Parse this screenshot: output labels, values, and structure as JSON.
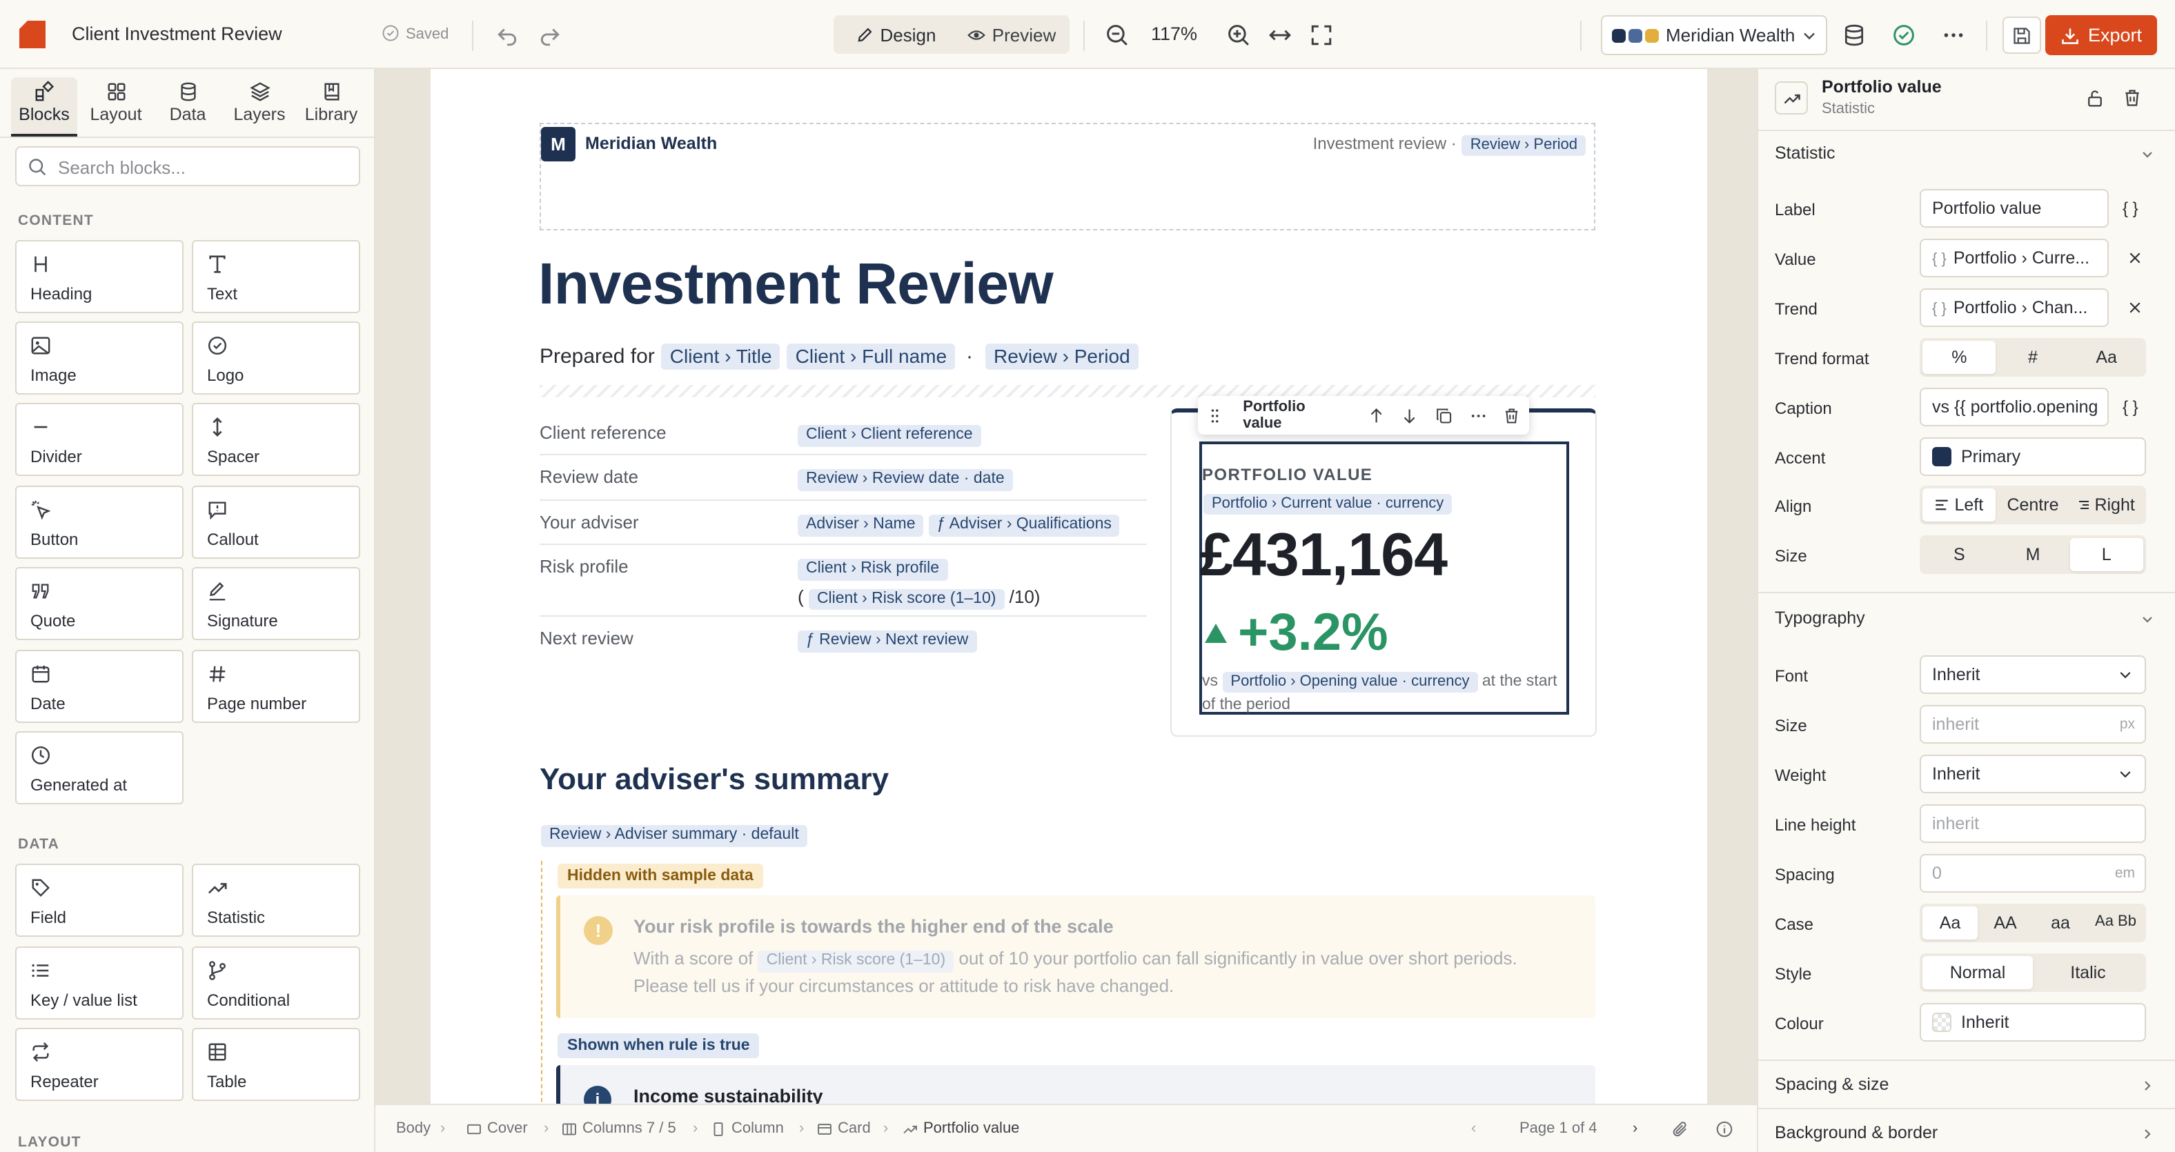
{
  "topbar": {
    "doc_title": "Client Investment Review",
    "saved_label": "Saved",
    "design_label": "Design",
    "preview_label": "Preview",
    "zoom": "117%",
    "brand_name": "Meridian Wealth",
    "export_label": "Export",
    "brand_colors": [
      "#1f3150",
      "#4b6a9a",
      "#e3ae3b"
    ],
    "accent": "#d9471c"
  },
  "left_panel": {
    "tabs": [
      "Blocks",
      "Layout",
      "Data",
      "Layers",
      "Library"
    ],
    "search_placeholder": "Search blocks...",
    "content_header": "CONTENT",
    "content_blocks": [
      {
        "label": "Heading",
        "icon": "heading-icon"
      },
      {
        "label": "Text",
        "icon": "text-icon"
      },
      {
        "label": "Image",
        "icon": "image-icon"
      },
      {
        "label": "Logo",
        "icon": "badge-check-icon"
      },
      {
        "label": "Divider",
        "icon": "divider-icon"
      },
      {
        "label": "Spacer",
        "icon": "spacer-icon"
      },
      {
        "label": "Button",
        "icon": "pointer-click-icon"
      },
      {
        "label": "Callout",
        "icon": "callout-icon"
      },
      {
        "label": "Quote",
        "icon": "quote-icon"
      },
      {
        "label": "Signature",
        "icon": "pen-icon"
      },
      {
        "label": "Date",
        "icon": "calendar-icon"
      },
      {
        "label": "Page number",
        "icon": "hash-icon"
      },
      {
        "label": "Generated at",
        "icon": "clock-icon"
      }
    ],
    "data_header": "DATA",
    "data_blocks": [
      {
        "label": "Field",
        "icon": "tag-icon"
      },
      {
        "label": "Statistic",
        "icon": "trend-icon"
      },
      {
        "label": "Key / value list",
        "icon": "list-icon"
      },
      {
        "label": "Conditional",
        "icon": "branch-icon"
      },
      {
        "label": "Repeater",
        "icon": "repeat-icon"
      },
      {
        "label": "Table",
        "icon": "table-icon"
      }
    ],
    "layout_header": "LAYOUT"
  },
  "document": {
    "brand_mark": "M",
    "brand_name": "Meridian Wealth",
    "header_right_text": "Investment review ·",
    "header_right_chip": "Review › Period",
    "title": "Investment Review",
    "prepared_for": "Prepared for",
    "prepared_chips": [
      "Client › Title",
      "Client › Full name",
      "Review › Period"
    ],
    "prepared_dot": "·",
    "details": [
      {
        "key": "Client reference",
        "chips": [
          "Client › Client reference"
        ]
      },
      {
        "key": "Review date",
        "chips": [
          "Review › Review date · date"
        ]
      },
      {
        "key": "Your adviser",
        "chips": [
          "Adviser › Name",
          "ƒ Adviser › Qualifications"
        ]
      },
      {
        "key": "Risk profile",
        "chips": [
          "Client › Risk profile"
        ],
        "line2_prefix": "(",
        "line2_chip": "Client › Risk score (1–10)",
        "line2_suffix": "/10)"
      },
      {
        "key": "Next review",
        "chips": [
          "ƒ Review › Next review"
        ]
      }
    ],
    "stat": {
      "toolbar_label": "Portfolio value",
      "label": "PORTFOLIO VALUE",
      "value_chip": "Portfolio › Current value · currency",
      "value": "£431,164",
      "trend": "+3.2%",
      "caption_prefix": "vs",
      "caption_chip": "Portfolio › Opening value · currency",
      "caption_suffix": "at the start of the period"
    },
    "summary_title": "Your adviser's summary",
    "summary_chip": "Review › Adviser summary · default",
    "hidden_badge": "Hidden with sample data",
    "warn_title": "Your risk profile is towards the higher end of the scale",
    "warn_body_prefix": "With a score of",
    "warn_body_chip": "Client › Risk score (1–10)",
    "warn_body_suffix": "out of 10 your portfolio can fall significantly in value over short periods. Please tell us if your circumstances or attitude to risk have changed.",
    "shown_badge": "Shown when rule is true",
    "info_title": "Income sustainability"
  },
  "statusbar": {
    "crumbs": [
      "Body",
      "Cover",
      "Columns 7 / 5",
      "Column",
      "Card",
      "Portfolio value"
    ],
    "page_indicator": "Page 1 of 4"
  },
  "inspector": {
    "title": "Portfolio value",
    "subtitle": "Statistic",
    "statistic_header": "Statistic",
    "label_prop": "Label",
    "label_value": "Portfolio value",
    "value_prop": "Value",
    "value_value": "Portfolio › Curre...",
    "trend_prop": "Trend",
    "trend_value": "Portfolio › Chan...",
    "bind_glyph": "{ }",
    "trend_format_prop": "Trend format",
    "trend_formats": [
      "%",
      "#",
      "Aa"
    ],
    "caption_prop": "Caption",
    "caption_value": "vs {{ portfolio.opening",
    "accent_prop": "Accent",
    "accent_value": "Primary",
    "accent_color": "#1f3150",
    "align_prop": "Align",
    "align_options": [
      "Left",
      "Centre",
      "Right"
    ],
    "size_prop": "Size",
    "size_options": [
      "S",
      "M",
      "L"
    ],
    "typography_header": "Typography",
    "font_prop": "Font",
    "font_value": "Inherit",
    "tsize_prop": "Size",
    "tsize_placeholder": "inherit",
    "tsize_unit": "px",
    "weight_prop": "Weight",
    "weight_value": "Inherit",
    "lineheight_prop": "Line height",
    "lineheight_placeholder": "inherit",
    "spacing_prop": "Spacing",
    "spacing_placeholder": "0",
    "spacing_unit": "em",
    "case_prop": "Case",
    "case_options": [
      "Aa",
      "AA",
      "aa",
      "Aa Bb"
    ],
    "style_prop": "Style",
    "style_options": [
      "Normal",
      "Italic"
    ],
    "colour_prop": "Colour",
    "colour_value": "Inherit",
    "spacing_size_header": "Spacing & size",
    "bg_border_header": "Background & border"
  }
}
